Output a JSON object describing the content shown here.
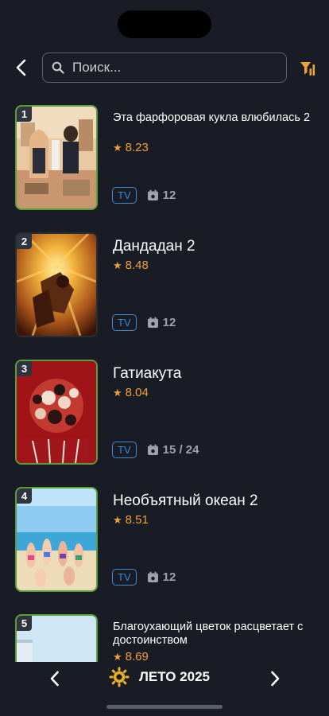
{
  "colors": {
    "background": "#191c25",
    "accent_orange": "#f0a23a",
    "badge_blue": "#3b8ad6",
    "poster_border": "#5b9e3c"
  },
  "search": {
    "placeholder": "Поиск...",
    "value": ""
  },
  "icons": {
    "back": "chevron-left-icon",
    "search": "search-icon",
    "filter": "filter-icon",
    "star": "star-icon",
    "episodes": "calendar-icon",
    "season": "sun-icon"
  },
  "star_glyph": "★",
  "items": [
    {
      "rank": "1",
      "title": "Эта фарфоровая кукла влюбилась 2",
      "rating": "8.23",
      "type": "TV",
      "episodes": "12"
    },
    {
      "rank": "2",
      "title": "Дандадан 2",
      "rating": "8.48",
      "type": "TV",
      "episodes": "12"
    },
    {
      "rank": "3",
      "title": "Гатиакута",
      "rating": "8.04",
      "type": "TV",
      "episodes": "15 / 24"
    },
    {
      "rank": "4",
      "title": "Необъятный океан 2",
      "rating": "8.51",
      "type": "TV",
      "episodes": "12"
    },
    {
      "rank": "5",
      "title": "Благоухающий цветок расцветает с достоинством",
      "rating": "8.69",
      "type": "",
      "episodes": ""
    }
  ],
  "season": {
    "label": "ЛЕТО 2025"
  }
}
